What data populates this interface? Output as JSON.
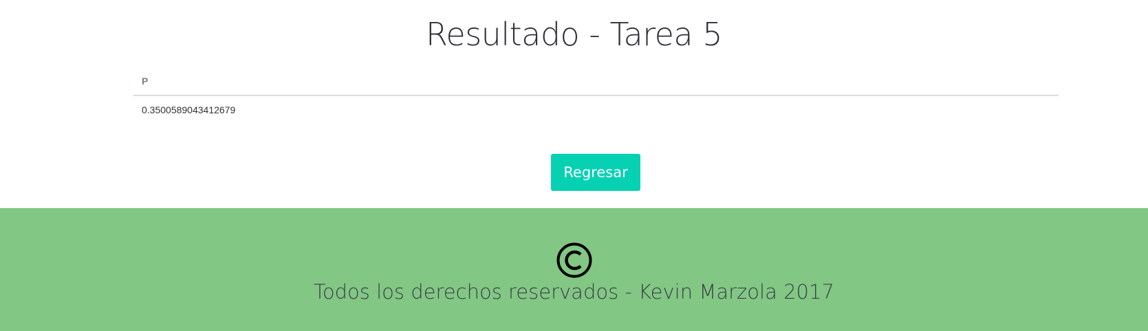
{
  "header": {
    "title": "Resultado - Tarea 5"
  },
  "results": {
    "columns": [
      "P"
    ],
    "rows": [
      [
        "0.3500589043412679"
      ]
    ]
  },
  "actions": {
    "back_label": "Regresar"
  },
  "footer": {
    "icon": "copyright-icon",
    "text": "Todos los derechos reservados - Kevin Marzola 2017"
  },
  "colors": {
    "button_background": "#06d1b3",
    "footer_background": "#82c784"
  }
}
